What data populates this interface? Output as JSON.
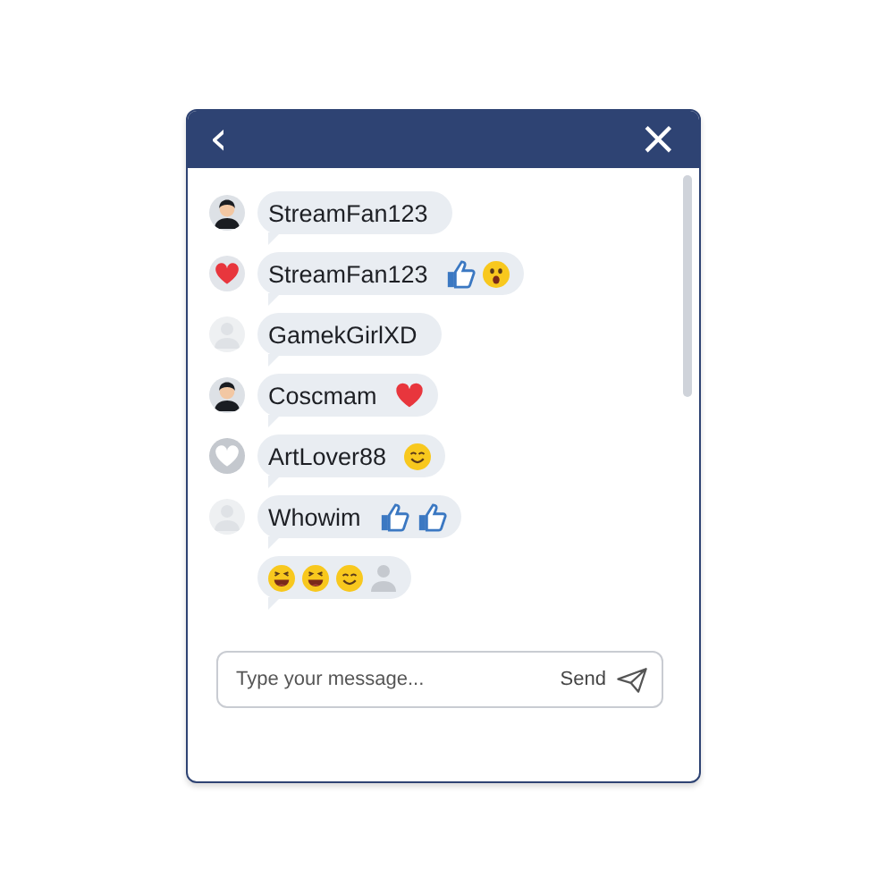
{
  "header": {
    "back": "‹",
    "close": "×"
  },
  "messages": [
    {
      "avatar": {
        "kind": "person"
      },
      "text": "StreamFan123"
    },
    {
      "avatar": {
        "kind": "heart"
      },
      "text": "StreamFan123",
      "reactions": [
        {
          "kind": "thumbs-up"
        },
        {
          "kind": "surprised"
        }
      ]
    },
    {
      "avatar": {
        "kind": "blank"
      },
      "text": "GamekGirlXD"
    },
    {
      "avatar": {
        "kind": "person"
      },
      "text": "Coscmam",
      "reactions": [
        {
          "kind": "heart"
        }
      ]
    },
    {
      "avatar": {
        "kind": "heart-outline"
      },
      "text": "ArtLover88",
      "reactions": [
        {
          "kind": "smile"
        }
      ]
    },
    {
      "avatar": {
        "kind": "blank"
      },
      "text": "Whowim",
      "reactions": [
        {
          "kind": "thumbs-up"
        },
        {
          "kind": "thumbs-up"
        }
      ]
    },
    {
      "reactions": [
        {
          "kind": "grin"
        },
        {
          "kind": "grin"
        },
        {
          "kind": "smile"
        },
        {
          "kind": "user"
        }
      ]
    }
  ],
  "composer": {
    "placeholder": "Type your message...",
    "send": "Send"
  }
}
